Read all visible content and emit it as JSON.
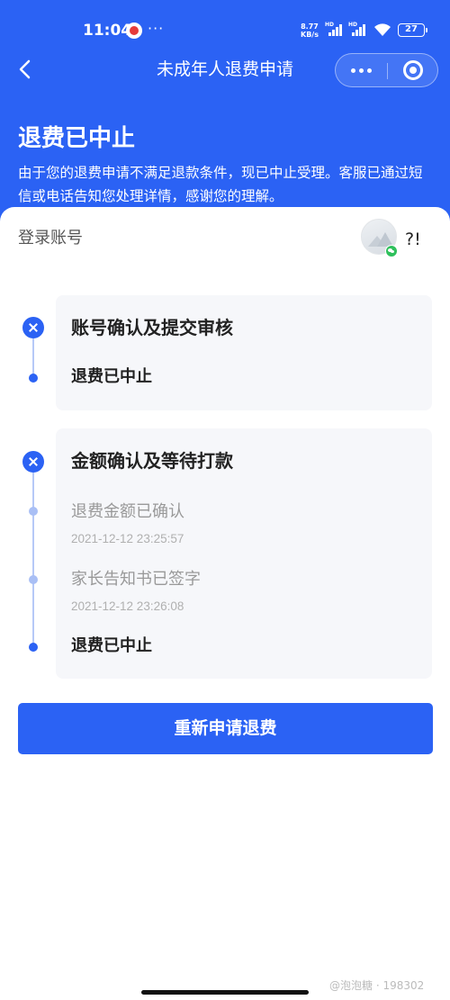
{
  "status_bar": {
    "time": "11:04",
    "notification_icon": "app-notification-icon",
    "more_indicator": "···",
    "network_speed_value": "8.77",
    "network_speed_unit": "KB/s",
    "signal_label_1": "HD",
    "signal_label_2": "HD",
    "battery": "27"
  },
  "nav": {
    "back_icon": "chevron-left-icon",
    "title": "未成年人退费申请",
    "more_icon": "more-dots-icon",
    "close_icon": "target-circle-icon"
  },
  "header": {
    "heading": "退费已中止",
    "description": "由于您的退费申请不满足退款条件，现已中止受理。客服已通过短信或电话告知您处理详情，感谢您的理解。"
  },
  "account": {
    "label": "登录账号",
    "value": "?!"
  },
  "sections": [
    {
      "title": "账号确认及提交审核",
      "steps": [
        {
          "label": "退费已中止",
          "time": ""
        }
      ]
    },
    {
      "title": "金额确认及等待打款",
      "steps": [
        {
          "label": "退费金额已确认",
          "time": "2021-12-12 23:25:57"
        },
        {
          "label": "家长告知书已签字",
          "time": "2021-12-12 23:26:08"
        },
        {
          "label": "退费已中止",
          "time": ""
        }
      ]
    }
  ],
  "action": {
    "reapply_label": "重新申请退费"
  },
  "watermark": "@泡泡糖 · 198302",
  "colors": {
    "primary": "#2b62f4",
    "card_bg": "#f6f7fa",
    "muted_text": "#999999"
  }
}
